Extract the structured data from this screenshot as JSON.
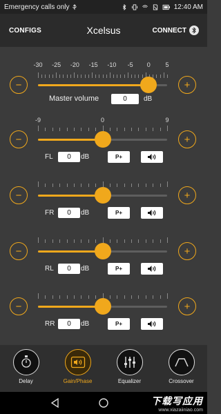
{
  "status_bar": {
    "left_text": "Emergency calls only",
    "time": "12:40 AM"
  },
  "app_bar": {
    "configs_label": "CONFIGS",
    "title": "Xcelsus",
    "connect_label": "CONNECT"
  },
  "master": {
    "scale_labels": [
      "-30",
      "-25",
      "-20",
      "-15",
      "-10",
      "-5",
      "0",
      "5"
    ],
    "label": "Master volume",
    "value": "0",
    "unit": "dB",
    "level_fraction": 0.857
  },
  "channel_scale": {
    "labels": [
      "-9",
      "0",
      "9"
    ]
  },
  "channels": [
    {
      "name": "FL",
      "value": "0",
      "unit": "dB",
      "preset_label": "P+",
      "level_fraction": 0.5
    },
    {
      "name": "FR",
      "value": "0",
      "unit": "dB",
      "preset_label": "P+",
      "level_fraction": 0.5
    },
    {
      "name": "RL",
      "value": "0",
      "unit": "dB",
      "preset_label": "P+",
      "level_fraction": 0.5
    },
    {
      "name": "RR",
      "value": "0",
      "unit": "dB",
      "preset_label": "P+",
      "level_fraction": 0.5
    }
  ],
  "buttons": {
    "minus_symbol": "−",
    "plus_symbol": "+"
  },
  "tabs": [
    {
      "label": "Delay",
      "icon": "delay-icon",
      "active": false
    },
    {
      "label": "Gain/Phase",
      "icon": "gain-phase-icon",
      "active": true
    },
    {
      "label": "Equalizer",
      "icon": "equalizer-icon",
      "active": false
    },
    {
      "label": "Crossover",
      "icon": "crossover-icon",
      "active": false
    }
  ],
  "watermark": {
    "big": "下载写应用",
    "small": "www.xiazaiiniao.com"
  },
  "colors": {
    "accent": "#f0a81c",
    "background": "#3b3b3b",
    "header": "#2b2b2b"
  }
}
